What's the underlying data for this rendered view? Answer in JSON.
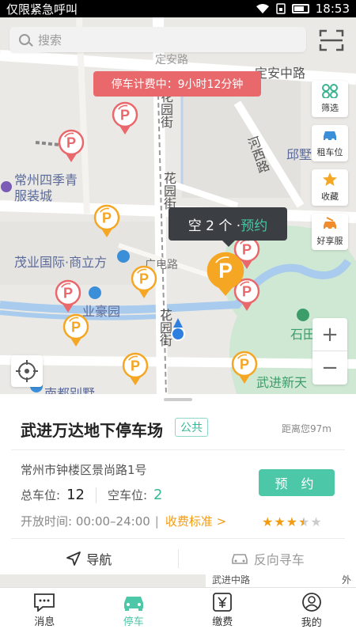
{
  "status_bar": {
    "carrier": "仅限紧急呼叫",
    "time": "18:53"
  },
  "search": {
    "placeholder": "搜索"
  },
  "parking_timer": "停车计费中：9小时12分钟",
  "map_tools": [
    {
      "label": "筛选",
      "icon": "filter-grid-icon"
    },
    {
      "label": "租车位",
      "icon": "car-icon"
    },
    {
      "label": "收藏",
      "icon": "star-icon"
    },
    {
      "label": "好享服",
      "icon": "service-car-icon"
    }
  ],
  "map_labels": {
    "street_1": "花园街",
    "street_2": "花园街",
    "street_3": "花园街",
    "street_dingan": "定安中路",
    "street_hexi": "河西路",
    "street_guangdian": "广电路",
    "street_dingan_top": "定安路",
    "poi_siji": "常州四季青服装城",
    "poi_siji_line2": "服装城",
    "poi_siji_line1": "常州四季青",
    "poi_maoye": "茂业国际·商立方",
    "poi_yehao": "业豪园",
    "poi_nandu": "南都别墅",
    "poi_qiu": "邱墅",
    "poi_shitian": "石田",
    "poi_wujin": "武进新天",
    "street_bottom": "武进中路",
    "edge_bottom": "外"
  },
  "bubble": {
    "available_text": "空 2 个 · ",
    "reserve_link": "预约"
  },
  "zoom": {
    "in": "+",
    "out": "−"
  },
  "lot": {
    "name": "武进万达地下停车场",
    "tag": "公共",
    "distance": "距离您97m",
    "address": "常州市钟楼区景尚路1号",
    "total_label": "总车位:",
    "total_value": "12",
    "free_label": "空车位:",
    "free_value": "2",
    "hours": "开放时间:  00:00–24:00",
    "fee_link": "收费标准 >",
    "reserve_button": "预 约",
    "rating": 3.5,
    "rating_max": 5
  },
  "actions": {
    "navigate": "导航",
    "reverse_find": "反向寻车"
  },
  "tabs": [
    {
      "label": "消息",
      "icon": "message-icon",
      "active": false
    },
    {
      "label": "停车",
      "icon": "car-icon",
      "active": true
    },
    {
      "label": "缴费",
      "icon": "yen-icon",
      "active": false
    },
    {
      "label": "我的",
      "icon": "user-icon",
      "active": false
    }
  ],
  "colors": {
    "accent": "#4cc7a8",
    "alert": "#e9686c",
    "pin_orange": "#f5a623",
    "pin_red": "#e9686c"
  }
}
